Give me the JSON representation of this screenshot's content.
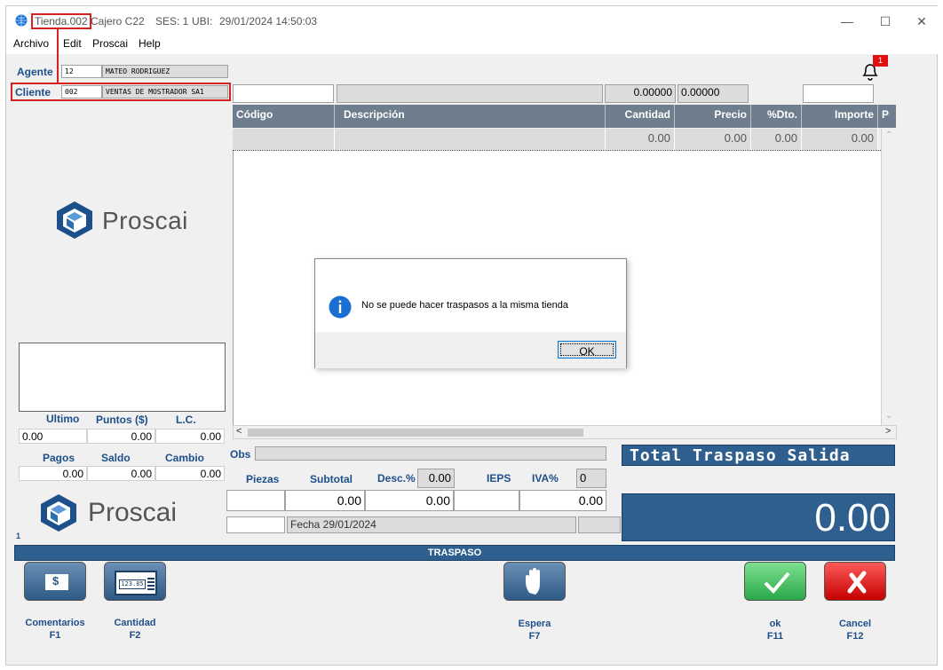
{
  "titlebar": {
    "tienda": "Tienda.002",
    "cajero": "Cajero C22",
    "ses": "SES: 1",
    "ubi": "UBI:",
    "datetime": "29/01/2024 14:50:03",
    "minimize": "—",
    "maximize": "☐",
    "close": "✕"
  },
  "menu": [
    "Archivo",
    "Edit",
    "Proscai",
    "Help"
  ],
  "notification_count": "1",
  "agente": {
    "label": "Agente",
    "code": "12",
    "name": "MATEO RODRIGUEZ"
  },
  "cliente": {
    "label": "Cliente",
    "code": "002",
    "name": "VENTAS DE MOSTRADOR SA1"
  },
  "top_fields": {
    "val1": "0.00000",
    "val2": "0.00000"
  },
  "table": {
    "headers": [
      "Código",
      "Descripción",
      "Cantidad",
      "Precio",
      "%Dto.",
      "Importe",
      "P"
    ],
    "row": [
      "",
      "",
      "0.00",
      "0.00",
      "0.00",
      "0.00"
    ]
  },
  "brand": "Proscai",
  "dialog": {
    "message": "No se puede hacer traspasos a la misma tienda",
    "ok": "OK"
  },
  "stats1": {
    "ultimo_label": "Ultimo",
    "puntos_label": "Puntos ($)",
    "lc_label": "L.C.",
    "ultimo": "0.00",
    "puntos": "0.00",
    "lc": "0.00"
  },
  "stats2": {
    "pagos_label": "Pagos",
    "saldo_label": "Saldo",
    "cambio_label": "Cambio",
    "pagos": "0.00",
    "saldo": "0.00",
    "cambio": "0.00"
  },
  "obs_label": "Obs",
  "totals": {
    "piezas_label": "Piezas",
    "subtotal_label": "Subtotal",
    "desc_label": "Desc.%",
    "desc_value": "0.00",
    "ieps_label": "IEPS",
    "iva_label": "IVA%",
    "iva_value": "0",
    "subtotal": "0.00",
    "desc_amount": "0.00",
    "iva_amount": "0.00"
  },
  "fecha": "Fecha 29/01/2024",
  "counter": "1",
  "total_title": "Total Traspaso Salida",
  "total_value": "0.00",
  "status_bar": "TRASPASO",
  "buttons": [
    {
      "label": "Comentarios",
      "key": "F1"
    },
    {
      "label": "Cantidad",
      "key": "F2"
    },
    {
      "label": "Espera",
      "key": "F7"
    },
    {
      "label": "ok",
      "key": "F11"
    },
    {
      "label": "Cancel",
      "key": "F12"
    }
  ],
  "calc_text": "123.85"
}
